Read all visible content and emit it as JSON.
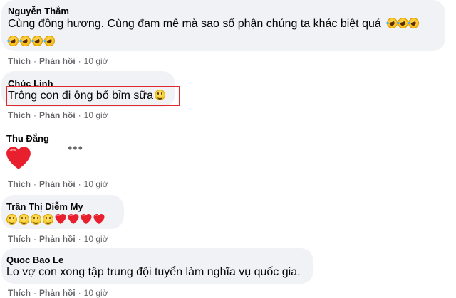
{
  "actions": {
    "like": "Thích",
    "reply": "Phản hồi",
    "separator": "·"
  },
  "comments": [
    {
      "author": "Nguyễn Thắm",
      "text": "Cùng đồng hương. Cùng đam mê mà sao số phận chúng ta khác biệt quá",
      "time": "10 giờ",
      "emoji": [
        "rolling-on-floor-laughing",
        "rolling-on-floor-laughing",
        "rolling-on-floor-laughing",
        "rolling-on-floor-laughing",
        "rolling-on-floor-laughing",
        "rolling-on-floor-laughing",
        "rolling-on-floor-laughing"
      ]
    },
    {
      "author": "Chúc Linh",
      "text": "Trông con đi ông bố bỉm sữa",
      "time": "10 giờ",
      "emoji": [
        "grinning-face"
      ]
    },
    {
      "author": "Thu Đắng",
      "text": "",
      "time": "10 giờ",
      "emoji": [
        "red-heart"
      ]
    },
    {
      "author": "Trần Thị Diễm My",
      "text": "",
      "time": "10 giờ",
      "emoji": [
        "grinning-face",
        "grinning-face",
        "grinning-face",
        "grinning-face",
        "red-heart",
        "red-heart",
        "red-heart",
        "red-heart"
      ]
    },
    {
      "author": "Quoc Bao Le",
      "text": "Lo vợ con xong tập trung đội tuyển làm nghĩa vụ quốc gia.",
      "time": "10 giờ",
      "emoji": []
    }
  ],
  "colors": {
    "highlight": "#e0282f",
    "bubble": "#f0f2f5",
    "meta": "#65676b",
    "heart": "#e8202e"
  }
}
